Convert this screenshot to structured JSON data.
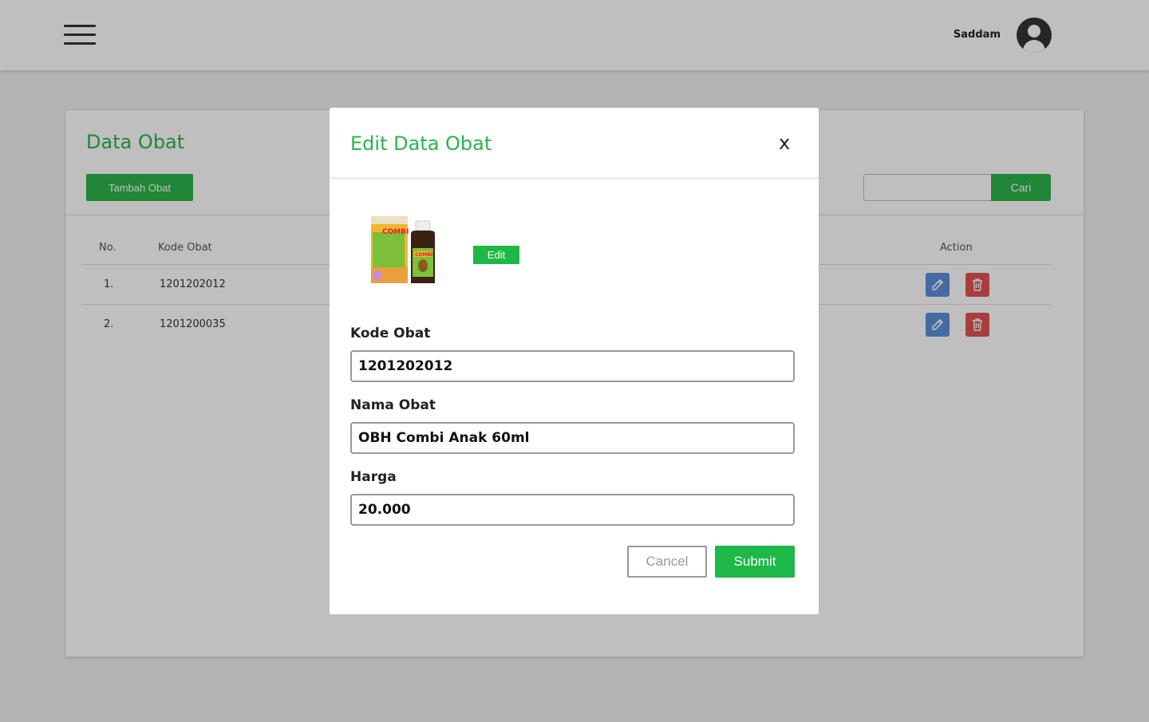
{
  "header": {
    "username": "Saddam"
  },
  "page": {
    "title": "Data Obat",
    "add_button": "Tambah Obat",
    "search_placeholder": "",
    "search_button": "Cari",
    "table": {
      "headers": [
        "No.",
        "Kode Obat",
        "Action"
      ],
      "rows": [
        {
          "no": "1.",
          "kode": "1201202012"
        },
        {
          "no": "2.",
          "kode": "1201200035"
        }
      ]
    }
  },
  "modal": {
    "title": "Edit Data Obat",
    "close": "x",
    "product_image": {
      "brand": "COMBI",
      "sub": "OBH",
      "variant": "ANAK"
    },
    "edit_image_button": "Edit",
    "fields": {
      "kode": {
        "label": "Kode Obat",
        "value": "1201202012"
      },
      "nama": {
        "label": "Nama Obat",
        "value": "OBH Combi Anak 60ml"
      },
      "harga": {
        "label": "Harga",
        "value": "20.000"
      }
    },
    "cancel_button": "Cancel",
    "submit_button": "Submit"
  },
  "colors": {
    "accent": "#2cb34a",
    "edit": "#5b8fd8",
    "delete": "#e05252"
  }
}
